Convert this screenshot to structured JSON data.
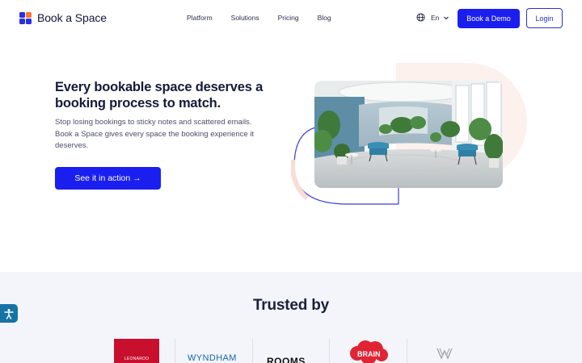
{
  "header": {
    "brand": "Book a Space",
    "nav": [
      "Platform",
      "Solutions",
      "Pricing",
      "Blog"
    ],
    "language": "En",
    "demo_label": "Book a Demo",
    "login_label": "Login"
  },
  "hero": {
    "title": "Every bookable space deserves a booking process to match.",
    "subtitle": "Stop losing bookings to sticky notes and scattered emails. Book a Space gives every space the booking experience it deserves.",
    "cta_label": "See it in action →"
  },
  "trusted": {
    "title": "Trusted by",
    "logos": [
      {
        "name": "leonardo-logo",
        "text": "LEONARDO"
      },
      {
        "name": "wyndham-logo",
        "text": "WYNDHAM"
      },
      {
        "name": "rooms-logo",
        "text": "ROOMS"
      },
      {
        "name": "the-brain-logo",
        "text": "BRAIN"
      },
      {
        "name": "w-monogram-logo",
        "text": ""
      }
    ]
  },
  "icons": {
    "globe": "globe-icon",
    "chevron": "chevron-down-icon",
    "accessibility": "accessibility-icon"
  },
  "colors": {
    "primary": "#1a1ff0",
    "logo_blue": "#2a2fe0",
    "logo_orange": "#f4793a",
    "accessibility": "#1673a5",
    "section_bg": "#f3f5fa"
  }
}
